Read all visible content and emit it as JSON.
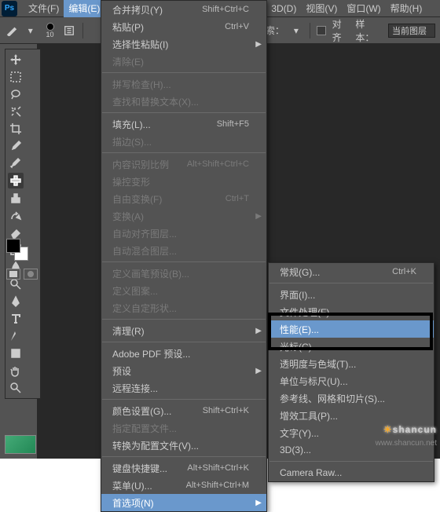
{
  "logo": "Ps",
  "menubar": {
    "file": "文件(F)",
    "edit": "编辑(E)",
    "d3": "3D(D)",
    "view": "视图(V)",
    "window": "窗口(W)",
    "help": "帮助(H)"
  },
  "toolbar": {
    "brush_size": "10",
    "search_label": "索：",
    "align_label": "对齐",
    "sample_label": "样本：",
    "sample_value": "当前图层"
  },
  "edit_menu": {
    "merge_copy": {
      "label": "合并拷贝(Y)",
      "sc": "Shift+Ctrl+C"
    },
    "paste": {
      "label": "粘贴(P)",
      "sc": "Ctrl+V"
    },
    "paste_special": {
      "label": "选择性粘贴(I)"
    },
    "clear": {
      "label": "清除(E)"
    },
    "spell": {
      "label": "拼写检查(H)..."
    },
    "find_replace": {
      "label": "查找和替换文本(X)..."
    },
    "fill": {
      "label": "填充(L)...",
      "sc": "Shift+F5"
    },
    "stroke": {
      "label": "描边(S)..."
    },
    "content_scale": {
      "label": "内容识别比例",
      "sc": "Alt+Shift+Ctrl+C"
    },
    "puppet": {
      "label": "操控变形"
    },
    "free_transform": {
      "label": "自由变换(F)",
      "sc": "Ctrl+T"
    },
    "transform": {
      "label": "变换(A)"
    },
    "auto_align": {
      "label": "自动对齐图层..."
    },
    "auto_blend": {
      "label": "自动混合图层..."
    },
    "brush_preset": {
      "label": "定义画笔预设(B)..."
    },
    "pattern": {
      "label": "定义图案..."
    },
    "custom_shape": {
      "label": "定义自定形状..."
    },
    "purge": {
      "label": "清理(R)"
    },
    "pdf_preset": {
      "label": "Adobe PDF 预设..."
    },
    "presets": {
      "label": "预设"
    },
    "remote": {
      "label": "远程连接..."
    },
    "color_settings": {
      "label": "颜色设置(G)...",
      "sc": "Shift+Ctrl+K"
    },
    "assign_profile": {
      "label": "指定配置文件..."
    },
    "convert_profile": {
      "label": "转换为配置文件(V)..."
    },
    "shortcuts": {
      "label": "键盘快捷键...",
      "sc": "Alt+Shift+Ctrl+K"
    },
    "menus": {
      "label": "菜单(U)...",
      "sc": "Alt+Shift+Ctrl+M"
    },
    "preferences": {
      "label": "首选项(N)"
    }
  },
  "prefs_menu": {
    "general": {
      "label": "常规(G)...",
      "sc": "Ctrl+K"
    },
    "interface": {
      "label": "界面(I)..."
    },
    "file_handling": {
      "label": "文件处理(F)..."
    },
    "performance": {
      "label": "性能(E)..."
    },
    "cursors": {
      "label": "光标(C)..."
    },
    "transparency": {
      "label": "透明度与色域(T)..."
    },
    "units": {
      "label": "单位与标尺(U)..."
    },
    "guides": {
      "label": "参考线、网格和切片(S)..."
    },
    "plugins": {
      "label": "增效工具(P)..."
    },
    "type": {
      "label": "文字(Y)..."
    },
    "d3": {
      "label": "3D(3)..."
    },
    "camera_raw": {
      "label": "Camera Raw..."
    }
  },
  "watermark": {
    "main": "shancun",
    "sub": "www.shancun.net"
  }
}
